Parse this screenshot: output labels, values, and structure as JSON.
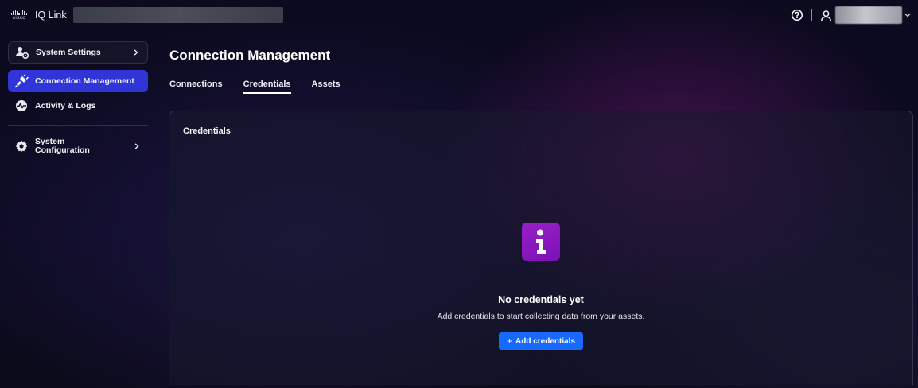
{
  "app": {
    "logo_text": "cisco",
    "title": "IQ Link"
  },
  "header": {
    "help_icon": "help-circle-icon",
    "user_icon": "user-icon",
    "user_menu_icon": "chevron-down-icon"
  },
  "sidebar": {
    "items": [
      {
        "label": "System Settings",
        "icon": "users-gear-icon",
        "has_chevron": true
      },
      {
        "label": "Connection Management",
        "icon": "plug-icon",
        "active": true
      },
      {
        "label": "Activity & Logs",
        "icon": "activity-icon"
      },
      {
        "label_line1": "System",
        "label_line2": "Configuration",
        "icon": "gear-icon",
        "has_chevron": true
      }
    ]
  },
  "main": {
    "title": "Connection Management",
    "tabs": [
      {
        "label": "Connections"
      },
      {
        "label": "Credentials",
        "active": true
      },
      {
        "label": "Assets"
      }
    ],
    "card": {
      "title": "Credentials",
      "empty_state": {
        "icon": "info-icon",
        "title": "No credentials yet",
        "description": "Add credentials to start collecting data from your assets.",
        "button_label": "Add credentials"
      }
    }
  },
  "colors": {
    "active_nav": "#2f35d6",
    "primary_button": "#1769ff",
    "info_tile": "#8c18c2"
  }
}
